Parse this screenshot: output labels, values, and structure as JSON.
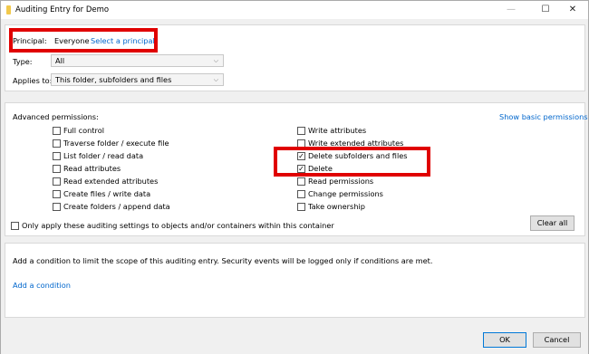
{
  "window": {
    "title": "Auditing Entry for Demo",
    "min_label": "—",
    "max_label": "☐",
    "close_label": "✕"
  },
  "principal": {
    "label": "Principal:",
    "value": "Everyone",
    "link": "Select a principal"
  },
  "type": {
    "label": "Type:",
    "value": "All"
  },
  "applies_to": {
    "label": "Applies to:",
    "value": "This folder, subfolders and files"
  },
  "advanced": {
    "label": "Advanced permissions:",
    "basic_link": "Show basic permissions",
    "left_column": [
      {
        "label": "Full control",
        "checked": false
      },
      {
        "label": "Traverse folder / execute file",
        "checked": false
      },
      {
        "label": "List folder / read data",
        "checked": false
      },
      {
        "label": "Read attributes",
        "checked": false
      },
      {
        "label": "Read extended attributes",
        "checked": false
      },
      {
        "label": "Create files / write data",
        "checked": false
      },
      {
        "label": "Create folders / append data",
        "checked": false
      }
    ],
    "right_column": [
      {
        "label": "Write attributes",
        "checked": false
      },
      {
        "label": "Write extended attributes",
        "checked": false
      },
      {
        "label": "Delete subfolders and files",
        "checked": true
      },
      {
        "label": "Delete",
        "checked": true
      },
      {
        "label": "Read permissions",
        "checked": false
      },
      {
        "label": "Change permissions",
        "checked": false
      },
      {
        "label": "Take ownership",
        "checked": false
      }
    ],
    "only_apply": {
      "label": "Only apply these auditing settings to objects and/or containers within this container",
      "checked": false
    },
    "clear_all": "Clear all"
  },
  "condition": {
    "description": "Add a condition to limit the scope of this auditing entry. Security events will be logged only if conditions are met.",
    "add_link": "Add a condition"
  },
  "footer": {
    "ok": "OK",
    "cancel": "Cancel"
  },
  "chevron": "⌵",
  "check": "✓"
}
